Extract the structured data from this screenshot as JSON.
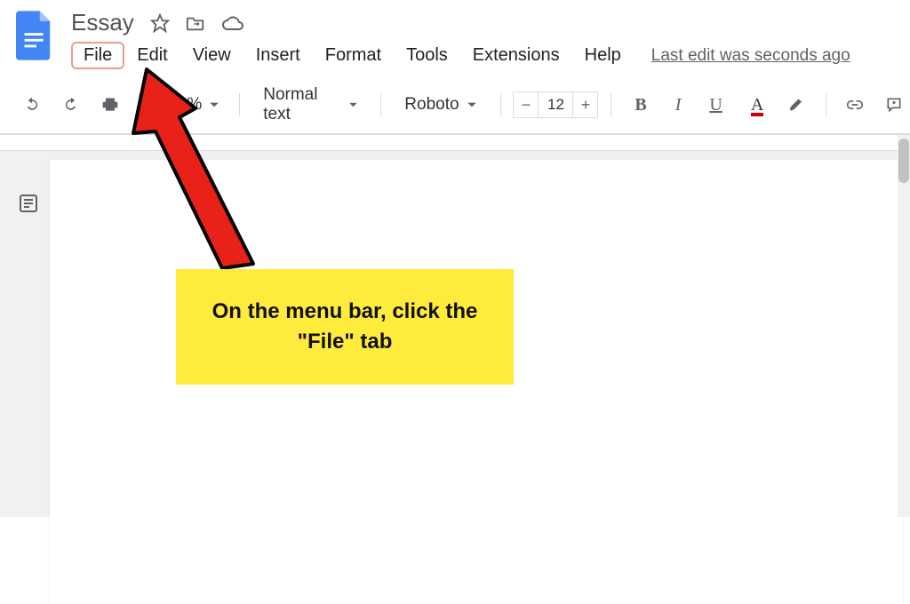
{
  "header": {
    "doc_title": "Essay"
  },
  "menu": {
    "items": [
      "File",
      "Edit",
      "View",
      "Insert",
      "Format",
      "Tools",
      "Extensions",
      "Help"
    ],
    "last_edit": "Last edit was seconds ago"
  },
  "toolbar": {
    "zoom": "100%",
    "style": "Normal text",
    "font": "Roboto",
    "font_size": "12"
  },
  "callout": {
    "text": "On the menu bar, click the \"File\" tab"
  },
  "colors": {
    "highlight_border": "#e6a08a",
    "callout_bg": "#ffeb3b",
    "arrow": "#e82219"
  }
}
